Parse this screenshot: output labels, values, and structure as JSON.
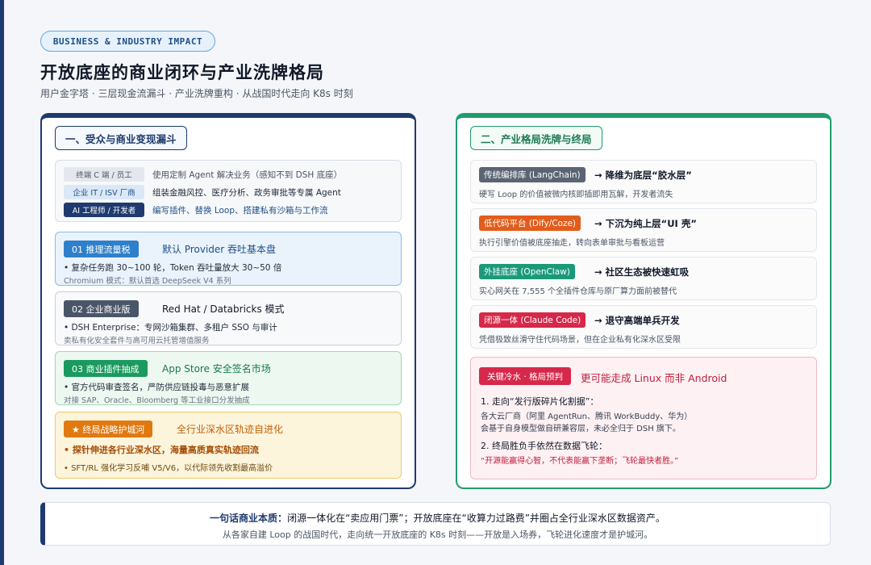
{
  "header": {
    "tag": "BUSINESS & INDUSTRY IMPACT",
    "title": "开放底座的商业闭环与产业洗牌格局",
    "subtitle": "用户金字塔 · 三层现金流漏斗 · 产业洗牌重构 · 从战国时代走向 K8s 时刻"
  },
  "left": {
    "heading": "一、受众与商业变现漏斗",
    "audiences": [
      {
        "badge": "终端 C 端 / 员工",
        "text": "使用定制 Agent 解决业务（感知不到 DSH 底座）"
      },
      {
        "badge": "企业 IT / ISV 厂商",
        "text": "组装金融风控、医疗分析、政务审批等专属 Agent"
      },
      {
        "badge": "AI 工程师 / 开发者",
        "text": "编写插件、替换 Loop、搭建私有沙箱与工作流"
      }
    ],
    "funnel": [
      {
        "badge": "01 推理流量税",
        "title": "默认 Provider 吞吐基本盘",
        "line1": "• 复杂任务跑 30~100 轮，Token 吞吐量放大 30~50 倍",
        "line2": "Chromium 模式：默认首选 DeepSeek V4 系列"
      },
      {
        "badge": "02 企业商业版",
        "title": "Red Hat / Databricks 模式",
        "line1": "• DSH Enterprise：专网沙箱集群、多租户 SSO 与审计",
        "line2": "卖私有化安全套件与高可用云托管增值服务"
      },
      {
        "badge": "03 商业插件抽成",
        "title": "App Store 安全签名市场",
        "line1": "• 官方代码审查签名，严防供应链投毒与恶意扩展",
        "line2": "对接 SAP、Oracle、Bloomberg 等工业接口分发抽成"
      },
      {
        "badge": "★ 终局战略护城河",
        "title": "全行业深水区轨迹自进化",
        "line1": "• 探针伸进各行业深水区，海量高质真实轨迹回流",
        "line2": "• SFT/RL 强化学习反哺 V5/V6，以代际领先收割最高溢价"
      }
    ]
  },
  "right": {
    "heading": "二、产业格局洗牌与终局",
    "items": [
      {
        "badge": "传统编排库 (LangChain)",
        "head": "→ 降维为底层“胶水层”",
        "desc": "硬写 Loop 的价值被微内核即插即用瓦解，开发者流失"
      },
      {
        "badge": "低代码平台 (Dify/Coze)",
        "head": "→ 下沉为纯上层“UI 壳”",
        "desc": "执行引擎价值被底座抽走，转向表单审批与看板运营"
      },
      {
        "badge": "外挂底座 (OpenClaw)",
        "head": "→ 社区生态被快速虹吸",
        "desc": "实心网关在 7,555 个全插件仓库与原厂算力面前被替代"
      },
      {
        "badge": "闭源一体 (Claude Code)",
        "head": "→ 退守高端单兵开发",
        "desc": "凭借极致丝滑守住代码场景，但在企业私有化深水区受限"
      }
    ],
    "verdict": {
      "badge": "关键冷水 · 格局预判",
      "title": "更可能走成 Linux 而非 Android",
      "p1_head": "1. 走向“发行版碎片化割据”：",
      "p1_line1": "各大云厂商（阿里 AgentRun、腾讯 WorkBuddy、华为）",
      "p1_line2": "会基于自身模型做自研兼容层，未必全归于 DSH 旗下。",
      "p2_head": "2. 终局胜负手依然在数据飞轮：",
      "p2_line": "“开源能赢得心智，不代表能赢下垄断；飞轮最快者胜。”"
    }
  },
  "bottom": {
    "line1_strong": "一句话商业本质：",
    "line1_rest": "闭源一体化在“卖应用门票”；开放底座在“收算力过路费”并圈占全行业深水区数据资产。",
    "line2": "从各家自建 Loop 的战国时代，走向统一开放底座的 K8s 时刻——开放是入场券，飞轮进化速度才是护城河。"
  },
  "colors": {
    "navy": "#1e3a6e",
    "green": "#1f9d6b",
    "blue_badge": "#2f80c9",
    "slate_badge": "#4a5568",
    "green_badge": "#1a9a5e",
    "orange_badge": "#e07a10",
    "red_badge": "#d6284a"
  }
}
